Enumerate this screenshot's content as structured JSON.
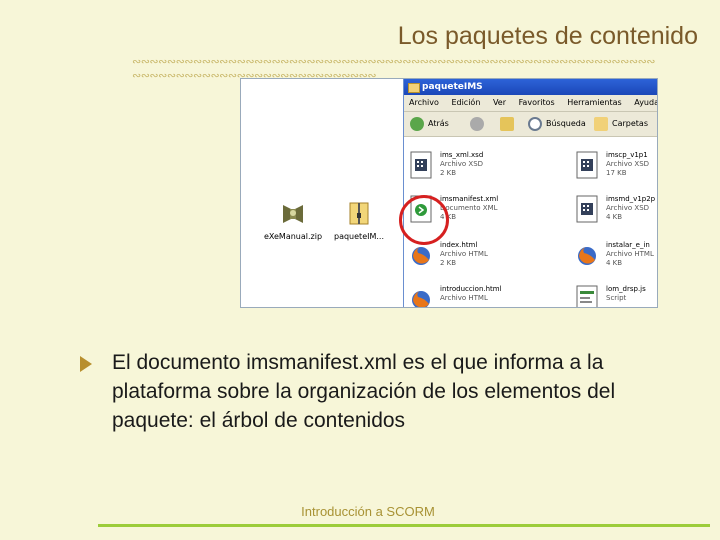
{
  "slide": {
    "title": "Los paquetes de contenido",
    "decoration": "&amp;",
    "bullet_text": "El documento imsmanifest.xml es el que informa a la plataforma sobre la organización de los elementos del paquete: el árbol de contenidos",
    "footer": "Introducción a SCORM"
  },
  "screenshot": {
    "desktop_icons": [
      {
        "label": "eXeManual.zip",
        "icon": "zip-icon"
      },
      {
        "label": "paqueteIM...",
        "icon": "zip-folder-icon"
      }
    ],
    "window": {
      "title": "paqueteIMS",
      "menu": [
        "Archivo",
        "Edición",
        "Ver",
        "Favoritos",
        "Herramientas",
        "Ayuda"
      ],
      "toolbar": {
        "back": "Atrás",
        "search": "Búsqueda",
        "folders": "Carpetas"
      },
      "files_left": [
        {
          "name": "ims_xml.xsd",
          "type": "Archivo XSD",
          "size": "2 KB",
          "icon": "xsd-file-icon"
        },
        {
          "name": "imsmanifest.xml",
          "type": "Documento XML",
          "size": "4 KB",
          "icon": "xml-file-icon"
        },
        {
          "name": "index.html",
          "type": "Archivo HTML",
          "size": "2 KB",
          "icon": "firefox-file-icon"
        },
        {
          "name": "introduccion.html",
          "type": "Archivo HTML",
          "size": "",
          "icon": "firefox-file-icon"
        }
      ],
      "files_right": [
        {
          "name": "imscp_v1p1",
          "type": "Archivo XSD",
          "size": "17 KB",
          "icon": "xsd-file-icon"
        },
        {
          "name": "imsmd_v1p2p",
          "type": "Archivo XSD",
          "size": "4 KB",
          "icon": "xsd-file-icon"
        },
        {
          "name": "instalar_e_in",
          "type": "Archivo HTML",
          "size": "4 KB",
          "icon": "firefox-file-icon"
        },
        {
          "name": "lom_drsp.js",
          "type": "Script",
          "size": "",
          "icon": "script-file-icon"
        }
      ]
    }
  },
  "colors": {
    "title": "#7a5a2a",
    "background": "#f7f6d8",
    "footer_line": "#9ccc3a",
    "highlight_ring": "#d62020"
  }
}
